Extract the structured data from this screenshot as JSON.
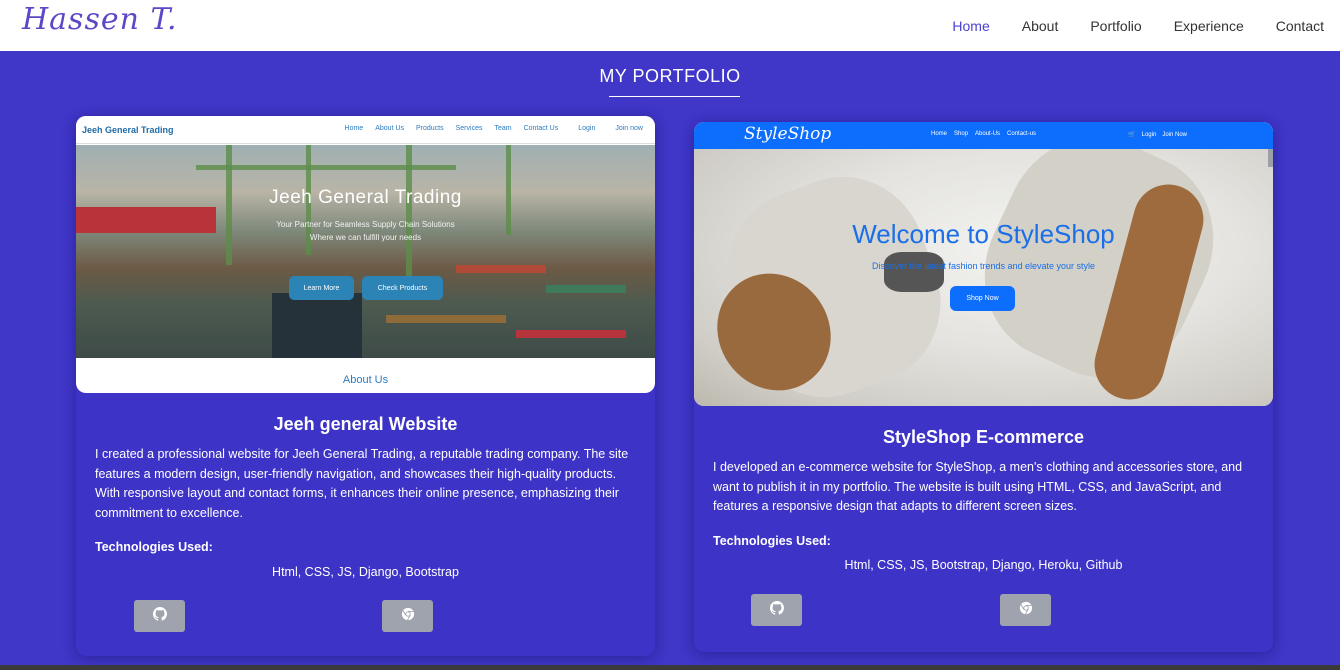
{
  "nav": {
    "logo": "Hassen T.",
    "links": [
      {
        "label": "Home",
        "active": true
      },
      {
        "label": "About",
        "active": false
      },
      {
        "label": "Portfolio",
        "active": false
      },
      {
        "label": "Experience",
        "active": false
      },
      {
        "label": "Contact",
        "active": false
      }
    ]
  },
  "section_title": "MY PORTFOLIO",
  "projects": [
    {
      "title": "Jeeh general Website",
      "description": "I created a professional website for Jeeh General Trading, a reputable trading company. The site features a modern design, user-friendly navigation, and showcases their high-quality products. With responsive layout and contact forms, it enhances their online presence, emphasizing their commitment to excellence.",
      "tech_label": "Technologies Used:",
      "tech": "Html, CSS, JS, Django, Bootstrap",
      "preview": {
        "brand": "Jeeh General Trading",
        "nav": [
          "Home",
          "About Us",
          "Products",
          "Services",
          "Team",
          "Contact Us",
          "Login",
          "Join now"
        ],
        "hero_title": "Jeeh General Trading",
        "hero_sub1": "Your Partner for Seamless Supply Chain Solutions",
        "hero_sub2": "Where we can fulfill your needs",
        "btn1": "Learn More",
        "btn2": "Check Products",
        "section": "About Us"
      }
    },
    {
      "title": "StyleShop E-commerce",
      "description": "I developed an e-commerce website for StyleShop, a men's clothing and accessories store, and want to publish it in my portfolio. The website is built using HTML, CSS, and JavaScript, and features a responsive design that adapts to different screen sizes.",
      "tech_label": "Technologies Used:",
      "tech": "Html, CSS, JS, Bootstrap, Django, Heroku, Github",
      "preview": {
        "brand": "StyleShop",
        "nav": [
          "Home",
          "Shop",
          "About-Us",
          "Contact-us"
        ],
        "login": "Login",
        "join": "Join Now",
        "hero_title": "Welcome to StyleShop",
        "hero_sub": "Discover the latest fashion trends and elevate your style",
        "btn": "Shop Now"
      }
    }
  ],
  "colors": {
    "background": "#4036c8",
    "card": "#3d33c6",
    "active_nav": "#4a3fd0",
    "button": "#9fa3ad"
  },
  "icons": [
    "github-icon",
    "chrome-icon"
  ]
}
